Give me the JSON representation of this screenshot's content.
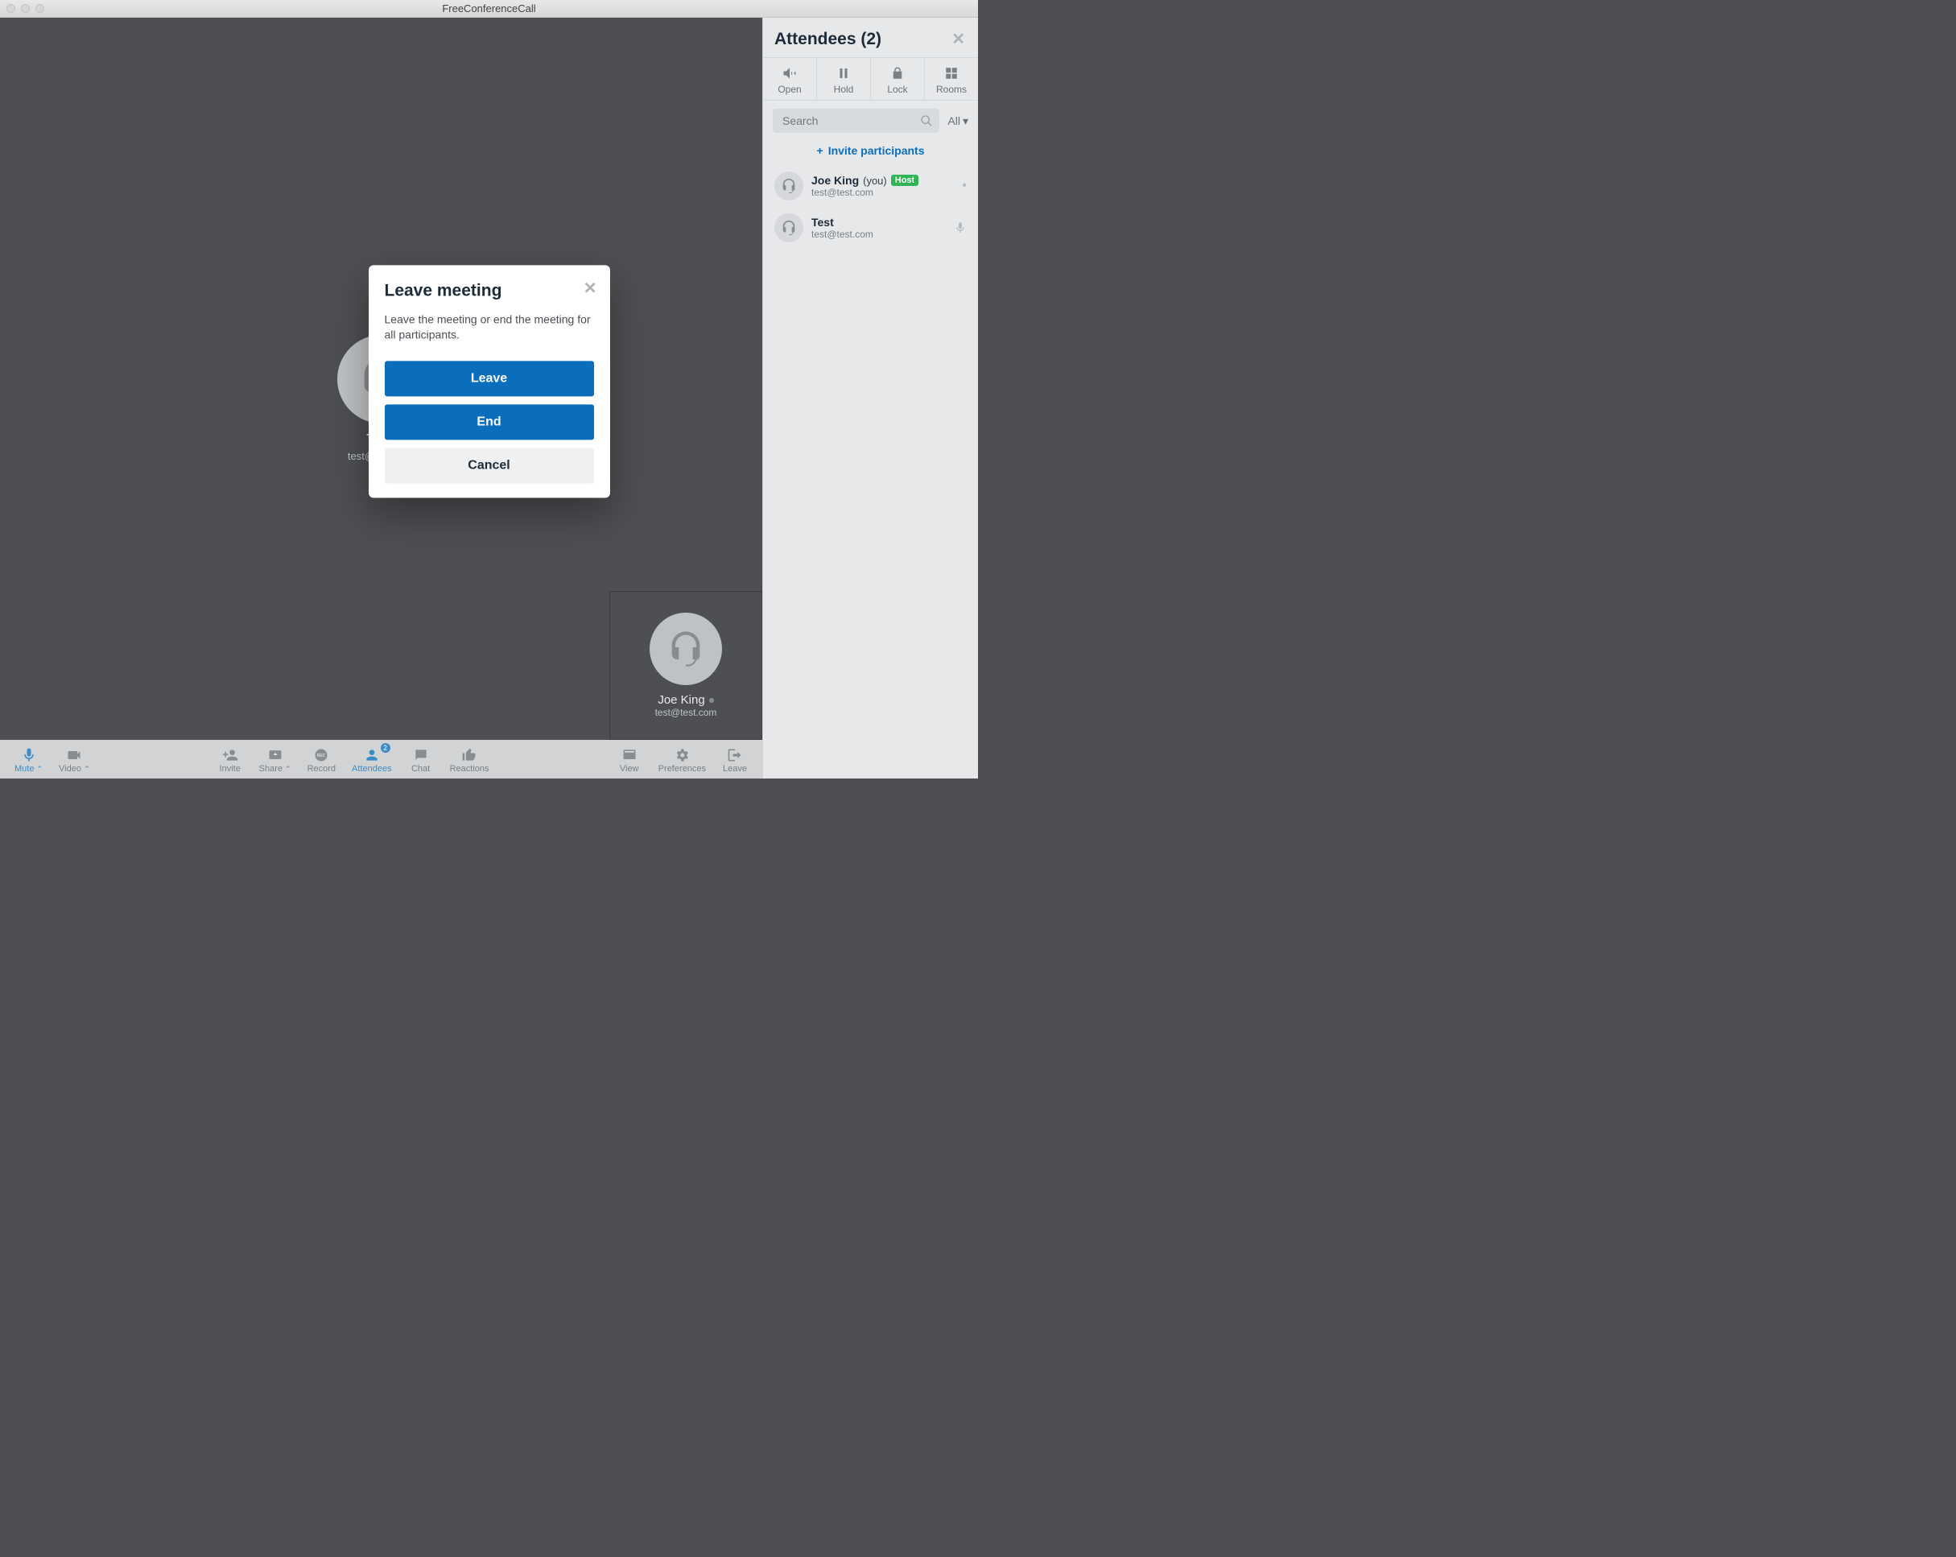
{
  "window": {
    "title": "FreeConferenceCall"
  },
  "stage": {
    "main_participant": {
      "name": "Test",
      "email": "test@test.com"
    },
    "self_tile": {
      "name": "Joe King",
      "email": "test@test.com"
    }
  },
  "toolbar": {
    "mute": "Mute",
    "video": "Video",
    "invite": "Invite",
    "share": "Share",
    "record": "Record",
    "attendees": "Attendees",
    "attendees_badge": "2",
    "chat": "Chat",
    "reactions": "Reactions",
    "view": "View",
    "preferences": "Preferences",
    "leave": "Leave"
  },
  "sidebar": {
    "title": "Attendees (2)",
    "actions": {
      "open": "Open",
      "hold": "Hold",
      "lock": "Lock",
      "rooms": "Rooms"
    },
    "search_placeholder": "Search",
    "filter_label": "All",
    "invite_label": "Invite participants",
    "participants": [
      {
        "name": "Joe King",
        "you": "(you)",
        "badge": "Host",
        "email": "test@test.com",
        "status": "dot"
      },
      {
        "name": "Test",
        "you": "",
        "badge": "",
        "email": "test@test.com",
        "status": "mic"
      }
    ]
  },
  "modal": {
    "title": "Leave meeting",
    "body": "Leave the meeting or end the meeting for all participants.",
    "leave": "Leave",
    "end": "End",
    "cancel": "Cancel"
  }
}
